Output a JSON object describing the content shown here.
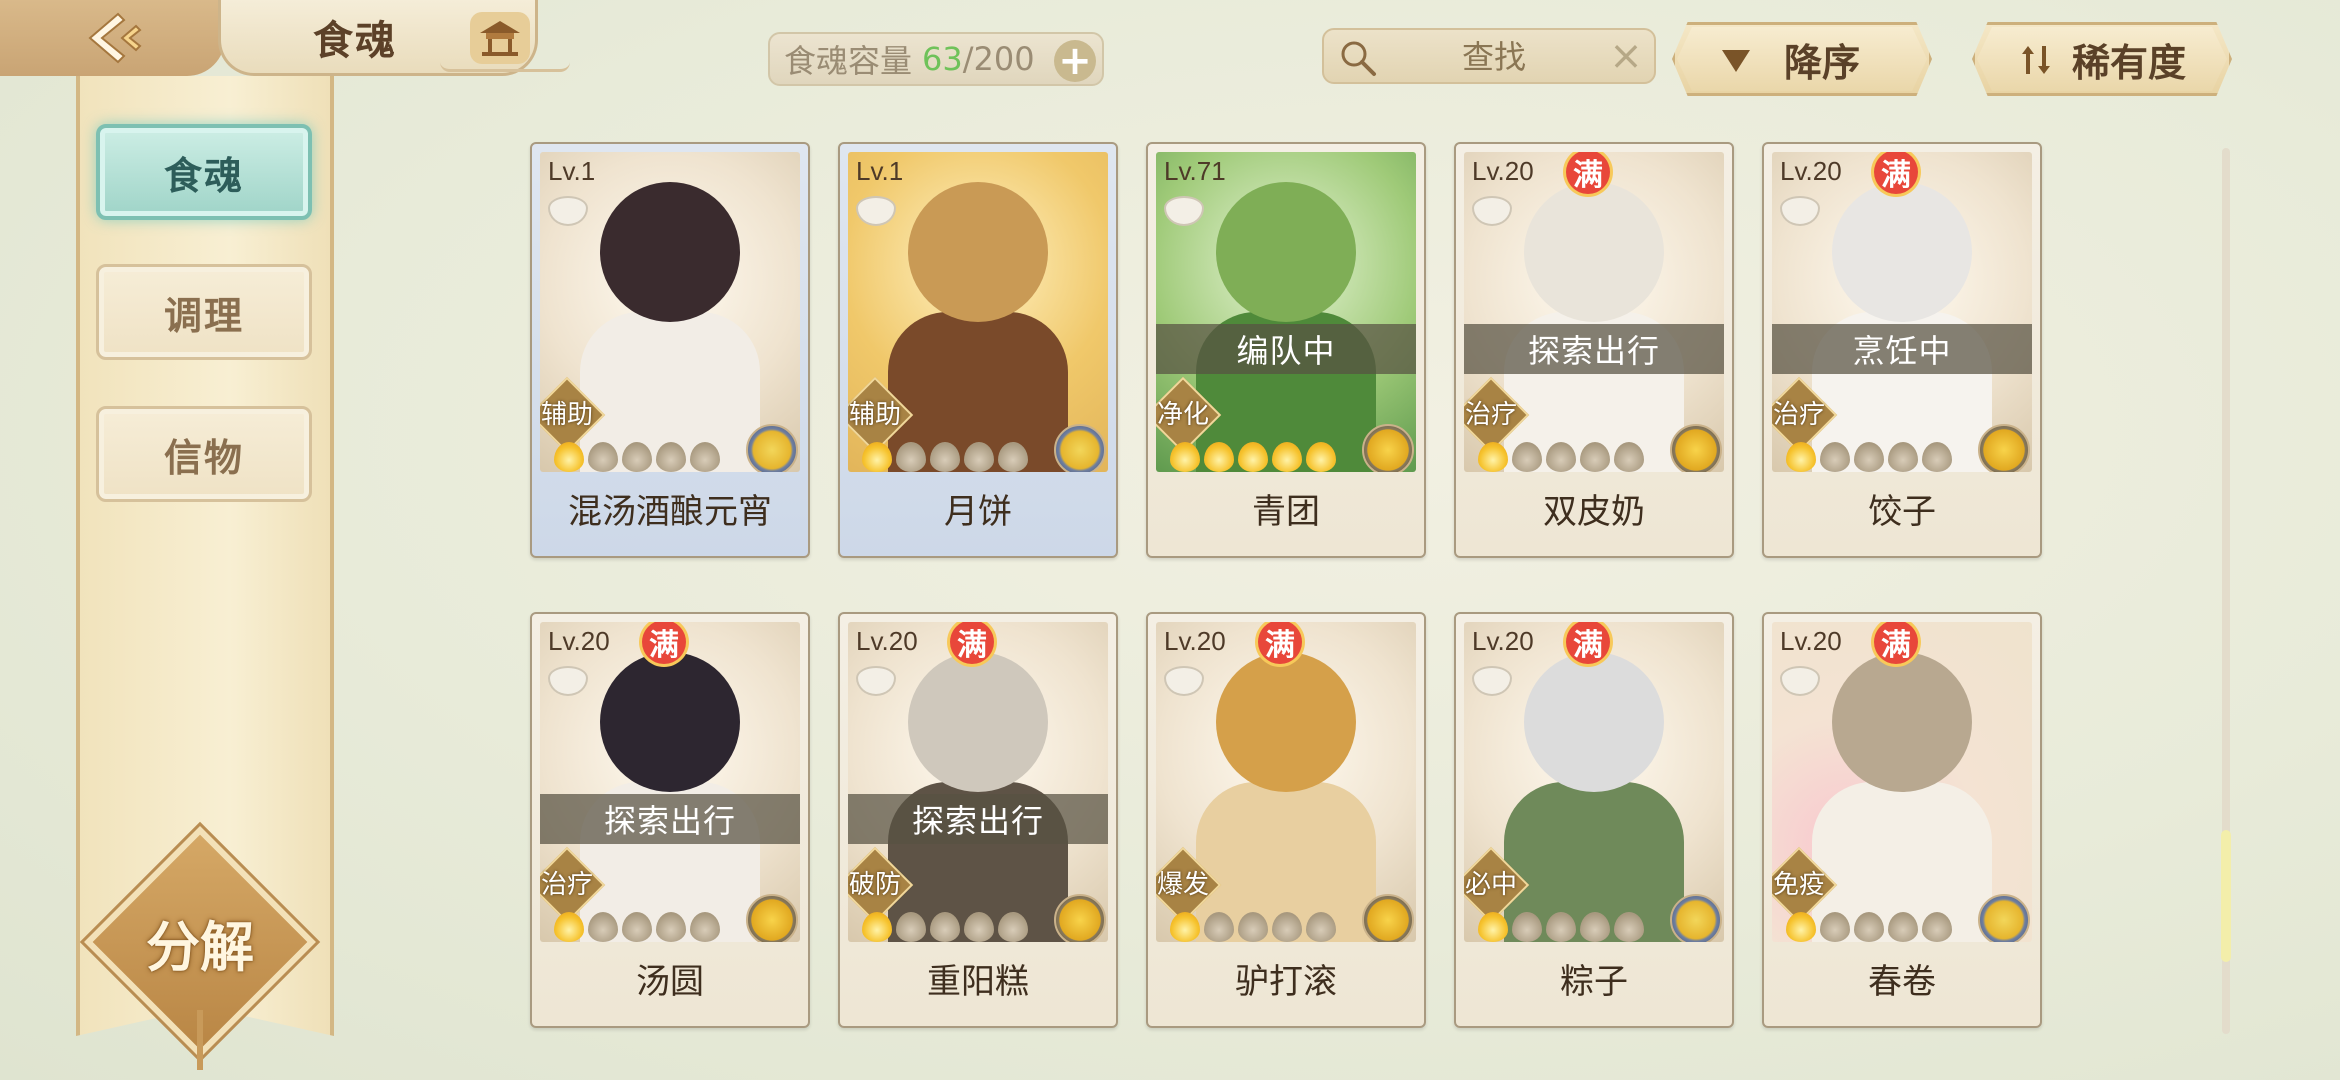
{
  "header": {
    "title": "食魂"
  },
  "sidebar": {
    "tabs": [
      {
        "label": "食魂",
        "active": true
      },
      {
        "label": "调理",
        "active": false
      },
      {
        "label": "信物",
        "active": false
      }
    ],
    "decompose_label": "分解"
  },
  "capacity": {
    "label": "食魂容量",
    "current": "63",
    "separator": "/",
    "max": "200",
    "add_symbol": "+"
  },
  "search": {
    "placeholder": "查找",
    "clear_symbol": "×"
  },
  "sort": {
    "order_label": "降序",
    "rarity_label": "稀有度"
  },
  "colors": {
    "accent_active_tab": "#9fd4c8",
    "capacity_current": "#6fc25a",
    "full_badge": "#e8473a"
  },
  "cards": [
    {
      "name": "混汤酒酿元宵",
      "level": "Lv.1",
      "full": false,
      "full_label": "",
      "status": "",
      "role": "辅助",
      "stars": 1
    },
    {
      "name": "月饼",
      "level": "Lv.1",
      "full": false,
      "full_label": "",
      "status": "",
      "role": "辅助",
      "stars": 1
    },
    {
      "name": "青团",
      "level": "Lv.71",
      "full": false,
      "full_label": "",
      "status": "编队中",
      "role": "净化",
      "stars": 5
    },
    {
      "name": "双皮奶",
      "level": "Lv.20",
      "full": true,
      "full_label": "满",
      "status": "探索出行",
      "role": "治疗",
      "stars": 1
    },
    {
      "name": "饺子",
      "level": "Lv.20",
      "full": true,
      "full_label": "满",
      "status": "烹饪中",
      "role": "治疗",
      "stars": 1
    },
    {
      "name": "汤圆",
      "level": "Lv.20",
      "full": true,
      "full_label": "满",
      "status": "探索出行",
      "role": "治疗",
      "stars": 1
    },
    {
      "name": "重阳糕",
      "level": "Lv.20",
      "full": true,
      "full_label": "满",
      "status": "探索出行",
      "role": "破防",
      "stars": 1
    },
    {
      "name": "驴打滚",
      "level": "Lv.20",
      "full": true,
      "full_label": "满",
      "status": "",
      "role": "爆发",
      "stars": 1
    },
    {
      "name": "粽子",
      "level": "Lv.20",
      "full": true,
      "full_label": "满",
      "status": "",
      "role": "必中",
      "stars": 1
    },
    {
      "name": "春卷",
      "level": "Lv.20",
      "full": true,
      "full_label": "满",
      "status": "",
      "role": "免疫",
      "stars": 1
    }
  ]
}
